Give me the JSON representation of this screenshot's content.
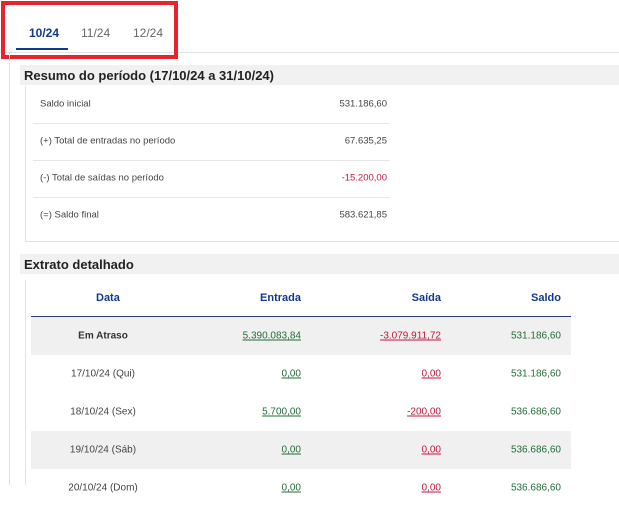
{
  "tabs": [
    {
      "label": "10/24",
      "active": true
    },
    {
      "label": "11/24",
      "active": false
    },
    {
      "label": "12/24",
      "active": false
    }
  ],
  "summary": {
    "title": "Resumo do período (17/10/24 a 31/10/24)",
    "rows": [
      {
        "label": "Saldo inicial",
        "value": "531.186,60"
      },
      {
        "label": "(+) Total de entradas no período",
        "value": "67.635,25"
      },
      {
        "label": "(-) Total de saídas no período",
        "value": "-15.200,00"
      },
      {
        "label": "(=) Saldo final",
        "value": "583.621,85"
      }
    ]
  },
  "extrato": {
    "title": "Extrato detalhado",
    "columns": {
      "date": "Data",
      "in": "Entrada",
      "out": "Saída",
      "balance": "Saldo"
    },
    "rows": [
      {
        "date": "Em Atraso",
        "in": "5.390.083,84",
        "out": "-3.079.911,72",
        "balance": "531.186,60"
      },
      {
        "date": "17/10/24 (Qui)",
        "in": "0,00",
        "out": "0,00",
        "balance": "531.186,60"
      },
      {
        "date": "18/10/24 (Sex)",
        "in": "5.700,00",
        "out": "-200,00",
        "balance": "536.686,60"
      },
      {
        "date": "19/10/24 (Sáb)",
        "in": "0,00",
        "out": "0,00",
        "balance": "536.686,60"
      },
      {
        "date": "20/10/24 (Dom)",
        "in": "0,00",
        "out": "0,00",
        "balance": "536.686,60"
      }
    ]
  },
  "colors": {
    "accent": "#123a8c",
    "positive": "#236c3a",
    "negative": "#c2173b",
    "highlight": "#e8232b"
  }
}
